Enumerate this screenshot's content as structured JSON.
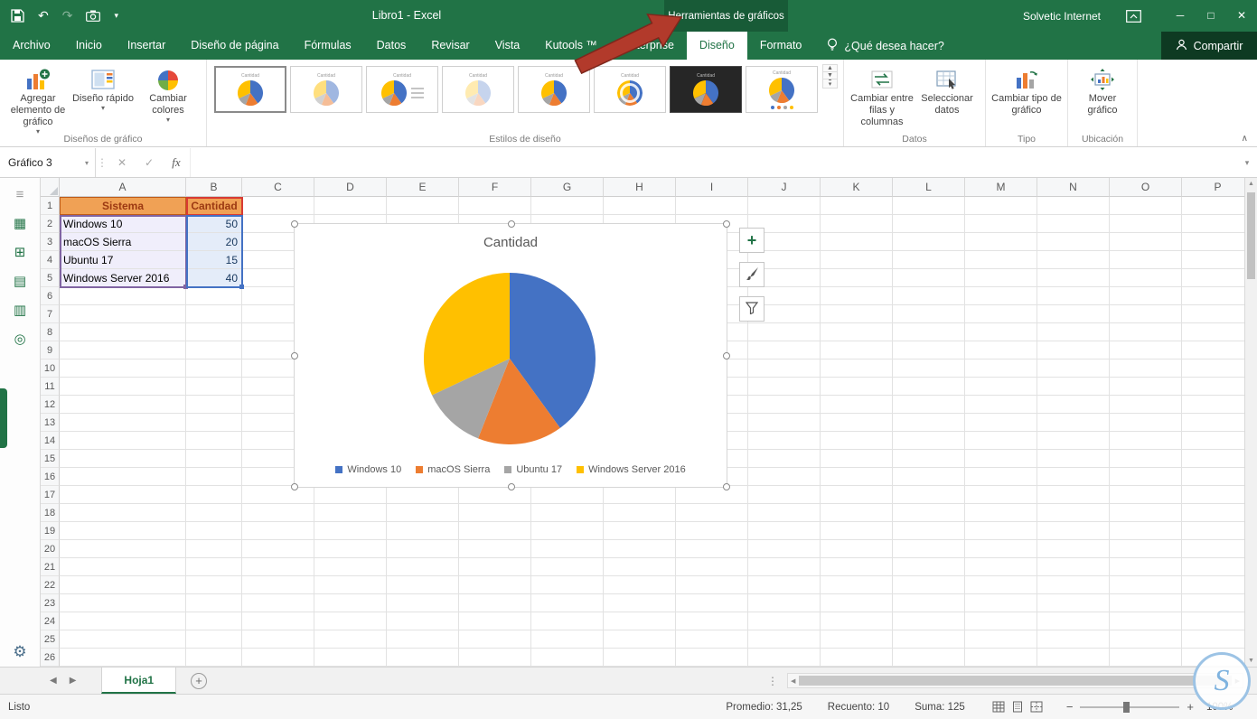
{
  "colors": {
    "accent_green": "#217346",
    "contextual_green": "#185b37",
    "arrow_red": "#b23a2b",
    "range_red": "#d83b33",
    "range_purple": "#8064a2",
    "range_blue": "#4472c4",
    "table_header_fill": "#f0a155",
    "table_header_text": "#9c3912"
  },
  "icons": {
    "undo": "↶",
    "redo": "↷",
    "caret_down": "▾",
    "dots": "⋮",
    "cancel": "✕",
    "check": "✓",
    "fx": "fx",
    "left": "◀",
    "right": "▶",
    "up": "▲",
    "down": "▼",
    "plus": "+",
    "gear": "⚙",
    "collapse": "∧",
    "minimize": "─",
    "maximize": "□",
    "close": "✕",
    "zoom_out": "−",
    "zoom_in": "+",
    "strip": [
      "≡",
      "▦",
      "⊞",
      "▤",
      "▥",
      "◎"
    ],
    "logo_letter": "S"
  },
  "titlebar": {
    "title": "Libro1  -  Excel",
    "contextual_label": "Herramientas de gráficos",
    "user": "Solvetic Internet"
  },
  "tabs": [
    {
      "label": "Archivo"
    },
    {
      "label": "Inicio"
    },
    {
      "label": "Insertar"
    },
    {
      "label": "Diseño de página"
    },
    {
      "label": "Fórmulas"
    },
    {
      "label": "Datos"
    },
    {
      "label": "Revisar"
    },
    {
      "label": "Vista"
    },
    {
      "label": "Kutools ™"
    },
    {
      "label": "Enterprise"
    },
    {
      "label": "Diseño",
      "active": true,
      "contextual": true
    },
    {
      "label": "Formato",
      "contextual": true
    }
  ],
  "tellme": "¿Qué desea hacer?",
  "share_label": "Compartir",
  "ribbon": {
    "left_buttons": [
      {
        "label": "Agregar elemento de gráfico"
      },
      {
        "label": "Diseño rápido"
      },
      {
        "label": "Cambiar colores"
      }
    ],
    "right_buttons": [
      {
        "label": "Cambiar entre filas y columnas"
      },
      {
        "label": "Seleccionar datos"
      },
      {
        "label": "Cambiar tipo de gráfico"
      },
      {
        "label": "Mover gráfico"
      }
    ],
    "groups": [
      "Diseños de gráfico",
      "Estilos de diseño",
      "Datos",
      "Tipo",
      "Ubicación"
    ],
    "gallery": [
      {
        "variant": "selected"
      },
      {
        "variant": "hatch"
      },
      {
        "variant": "label-right"
      },
      {
        "variant": "pale"
      },
      {
        "variant": "plain"
      },
      {
        "variant": "striped"
      },
      {
        "variant": "dark"
      },
      {
        "variant": "markers"
      }
    ]
  },
  "formula_bar": {
    "name_box": "Gráfico 3"
  },
  "grid": {
    "columns": [
      "A",
      "B",
      "C",
      "D",
      "E",
      "F",
      "G",
      "H",
      "I",
      "J",
      "K",
      "L",
      "M",
      "N",
      "O",
      "P"
    ],
    "row_count": 26,
    "table": {
      "headers": [
        "Sistema",
        "Cantidad"
      ],
      "rows": [
        {
          "sistema": "Windows 10",
          "cantidad": "50"
        },
        {
          "sistema": "macOS Sierra",
          "cantidad": "20"
        },
        {
          "sistema": "Ubuntu 17",
          "cantidad": "15"
        },
        {
          "sistema": "Windows Server 2016",
          "cantidad": "40"
        }
      ]
    }
  },
  "chart_data": {
    "type": "pie",
    "title": "Cantidad",
    "categories": [
      "Windows 10",
      "macOS Sierra",
      "Ubuntu 17",
      "Windows Server 2016"
    ],
    "values": [
      50,
      20,
      15,
      40
    ],
    "colors": [
      "#4472C4",
      "#ED7D31",
      "#A5A5A5",
      "#FFC000"
    ],
    "total": 125,
    "legend_position": "bottom"
  },
  "sheet_bar": {
    "tab": "Hoja1"
  },
  "status_bar": {
    "ready": "Listo",
    "stats": [
      "Promedio: 31,25",
      "Recuento: 10",
      "Suma: 125"
    ],
    "zoom": "100%"
  }
}
